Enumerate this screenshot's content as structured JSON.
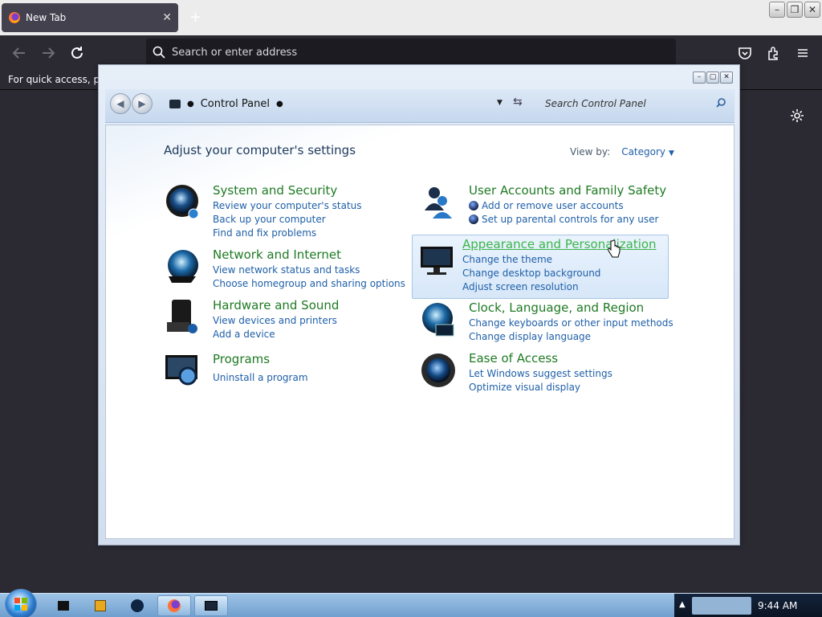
{
  "browser": {
    "tab_title": "New Tab",
    "tab_close": "✕",
    "new_tab": "+",
    "url_placeholder": "Search or enter address",
    "bookmarks_text": "For quick access, plac",
    "window_controls": [
      "–",
      "❐",
      "✕"
    ]
  },
  "control_panel": {
    "window_controls": [
      "–",
      "▢",
      "✕"
    ],
    "breadcrumb": "Control Panel",
    "search_placeholder": "Search Control Panel",
    "heading": "Adjust your computer's settings",
    "view_by_label": "View by:",
    "view_by_value": "Category",
    "categories": [
      {
        "title": "System and Security",
        "icon": "system-security-icon",
        "links": [
          "Review your computer's status",
          "Back up your computer",
          "Find and fix problems"
        ]
      },
      {
        "title": "Network and Internet",
        "icon": "network-globe-icon",
        "links": [
          "View network status and tasks",
          "Choose homegroup and sharing options"
        ]
      },
      {
        "title": "Hardware and Sound",
        "icon": "hardware-sound-icon",
        "links": [
          "View devices and printers",
          "Add a device"
        ]
      },
      {
        "title": "Programs",
        "icon": "programs-icon",
        "links": [
          "Uninstall a program"
        ]
      },
      {
        "title": "User Accounts and Family Safety",
        "icon": "user-accounts-icon",
        "links": [
          "Add or remove user accounts",
          "Set up parental controls for any user"
        ]
      },
      {
        "title": "Appearance and Personalization",
        "icon": "appearance-monitor-icon",
        "links": [
          "Change the theme",
          "Change desktop background",
          "Adjust screen resolution"
        ]
      },
      {
        "title": "Clock, Language, and Region",
        "icon": "clock-language-globe-icon",
        "links": [
          "Change keyboards or other input methods",
          "Change display language"
        ]
      },
      {
        "title": "Ease of Access",
        "icon": "ease-of-access-icon",
        "links": [
          "Let Windows suggest settings",
          "Optimize visual display"
        ]
      }
    ]
  },
  "taskbar": {
    "clock": "9:44 AM",
    "tray_arrow": "▲"
  },
  "colors": {
    "link_blue": "#1e5fa8",
    "category_green": "#1e7a23",
    "hover_green": "#3bb54a"
  }
}
